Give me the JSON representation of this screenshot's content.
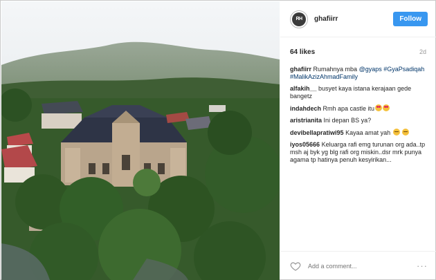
{
  "post": {
    "image_alt": "",
    "username": "ghafiirr",
    "avatar_text": "RH",
    "follow_label": "Follow",
    "likes": "64 likes",
    "time": "2d",
    "caption": {
      "user": "ghafiirr",
      "text": "Rumahnya mba",
      "mention": "@gyaps",
      "hashtags": "#GyaPsadiqah #MalikAzizAhmadFamily"
    },
    "comments": [
      {
        "user": "alfakih__",
        "text": "busyet kaya istana kerajaan gede bangetz",
        "emoji": ""
      },
      {
        "user": "indahdech",
        "text": "Rmh apa castle itu",
        "emoji": "heart-eyes"
      },
      {
        "user": "aristrianita",
        "text": "Ini depan BS ya?",
        "emoji": ""
      },
      {
        "user": "devibellapratiwi95",
        "text": "Kayaa amat yah",
        "emoji": "sweat"
      },
      {
        "user": "iyos05666",
        "text": "Keluarga rafi emg turunan org ada..tp msh aj byk yg blg rafi org miskin..dsr mrk punya agama tp hatinya penuh kesyirikan...",
        "emoji": ""
      }
    ],
    "add_comment_placeholder": "Add a comment...",
    "more_label": "···",
    "icons": {
      "heart": "heart-outline-icon",
      "more": "more-dots-icon"
    }
  }
}
